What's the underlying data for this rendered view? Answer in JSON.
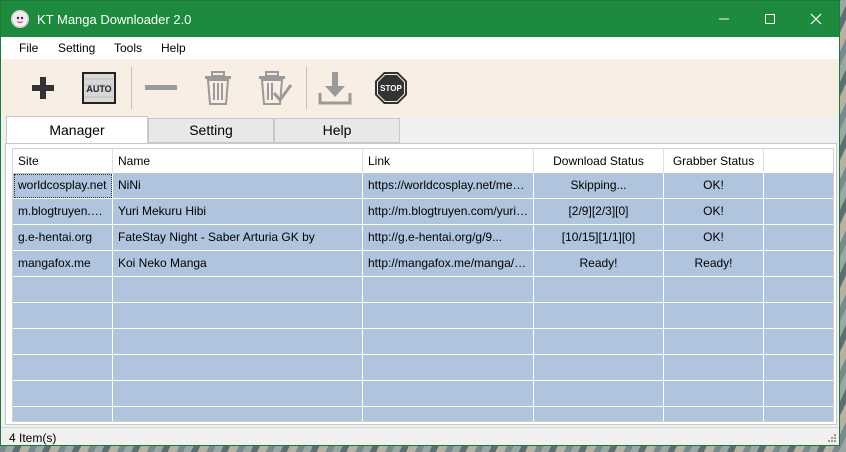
{
  "window": {
    "title": "KT Manga Downloader 2.0",
    "accent": "#1e8a3d"
  },
  "menu": [
    "File",
    "Setting",
    "Tools",
    "Help"
  ],
  "toolbar": {
    "auto_label": "AUTO",
    "stop_label": "STOP",
    "icons": [
      "add-icon",
      "auto-icon",
      "remove-icon",
      "delete-icon",
      "delete-checked-icon",
      "download-icon",
      "stop-icon"
    ]
  },
  "tabs": [
    {
      "label": "Manager",
      "active": true
    },
    {
      "label": "Setting",
      "active": false
    },
    {
      "label": "Help",
      "active": false
    }
  ],
  "table": {
    "columns": [
      "Site",
      "Name",
      "Link",
      "Download Status",
      "Grabber Status"
    ],
    "rows": [
      {
        "site": "worldcosplay.net",
        "name": "NiNi",
        "link": "https://worldcosplay.net/member/nini",
        "download_status": "Skipping...",
        "grabber_status": "OK!"
      },
      {
        "site": "m.blogtruyen.com",
        "name": "Yuri Mekuru Hibi",
        "link": "http://m.blogtruyen.com/yuri-mekuru-hibi",
        "download_status": "[2/9][2/3][0]",
        "grabber_status": "OK!"
      },
      {
        "site": "g.e-hentai.org",
        "name": "FateStay Night - Saber Arturia GK by",
        "link": "http://g.e-hentai.org/g/9...",
        "download_status": "[10/15][1/1][0]",
        "grabber_status": "OK!"
      },
      {
        "site": "mangafox.me",
        "name": "Koi Neko Manga",
        "link": "http://mangafox.me/manga/koi_neko",
        "download_status": "Ready!",
        "grabber_status": "Ready!"
      }
    ],
    "row_color": "#b0c4de"
  },
  "status": {
    "items_text": "4 Item(s)"
  }
}
